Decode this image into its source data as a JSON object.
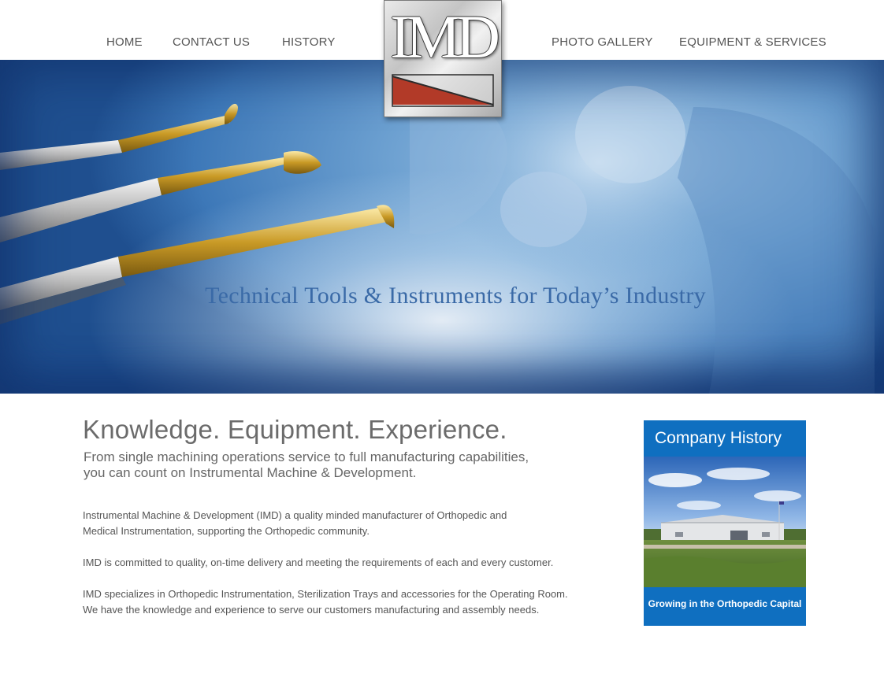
{
  "nav": {
    "home": "HOME",
    "contact": "CONTACT US",
    "history": "HISTORY",
    "gallery": "PHOTO GALLERY",
    "equipment": "EQUIPMENT & SERVICES"
  },
  "logo": {
    "text": "IMD"
  },
  "hero": {
    "tagline": "Technical Tools & Instruments for Today’s Industry"
  },
  "main": {
    "headline": "Knowledge. Equipment. Experience.",
    "subhead": [
      "From single machining operations service to full manufacturing capabilities,",
      "you can count on Instrumental Machine & Development."
    ],
    "paragraphs": [
      "Instrumental Machine & Development (IMD) a quality minded manufacturer of Orthopedic and",
      "Medical Instrumentation, supporting the Orthopedic community.",
      "IMD is committed to quality, on-time delivery and meeting the requirements of each and every customer.",
      "IMD specializes in Orthopedic Instrumentation, Sterilization Trays and accessories for the Operating Room.",
      "We have the knowledge and experience to serve our customers manufacturing and assembly needs."
    ]
  },
  "sidebar": {
    "title": "Company History",
    "caption": "Growing in the Orthopedic Capital"
  },
  "colors": {
    "nav_text": "#555555",
    "tagline": "#3a6aa7",
    "card_blue": "#0f6fc0",
    "logo_red": "#b23a28"
  }
}
